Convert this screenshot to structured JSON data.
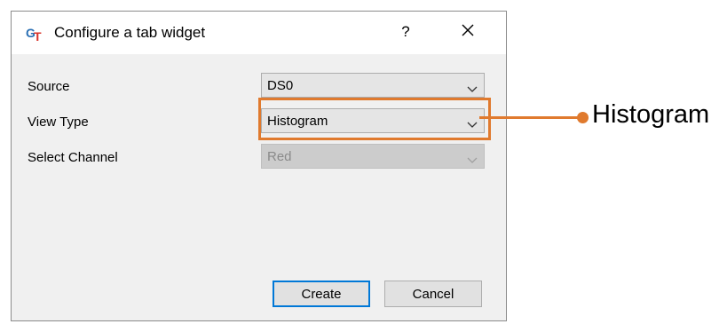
{
  "dialog": {
    "title": "Configure a tab widget",
    "help_label": "?",
    "app_icon": "app-logo-icon",
    "close_icon": "close-icon"
  },
  "fields": {
    "source": {
      "label": "Source",
      "value": "DS0"
    },
    "view_type": {
      "label": "View Type",
      "value": "Histogram"
    },
    "select_channel": {
      "label": "Select Channel",
      "value": "Red",
      "disabled": true
    }
  },
  "buttons": {
    "create": "Create",
    "cancel": "Cancel"
  },
  "callout": {
    "text": "Histogram",
    "color": "#e07a2e"
  },
  "colors": {
    "accent": "#e07a2e",
    "default_button_border": "#0078d7"
  }
}
